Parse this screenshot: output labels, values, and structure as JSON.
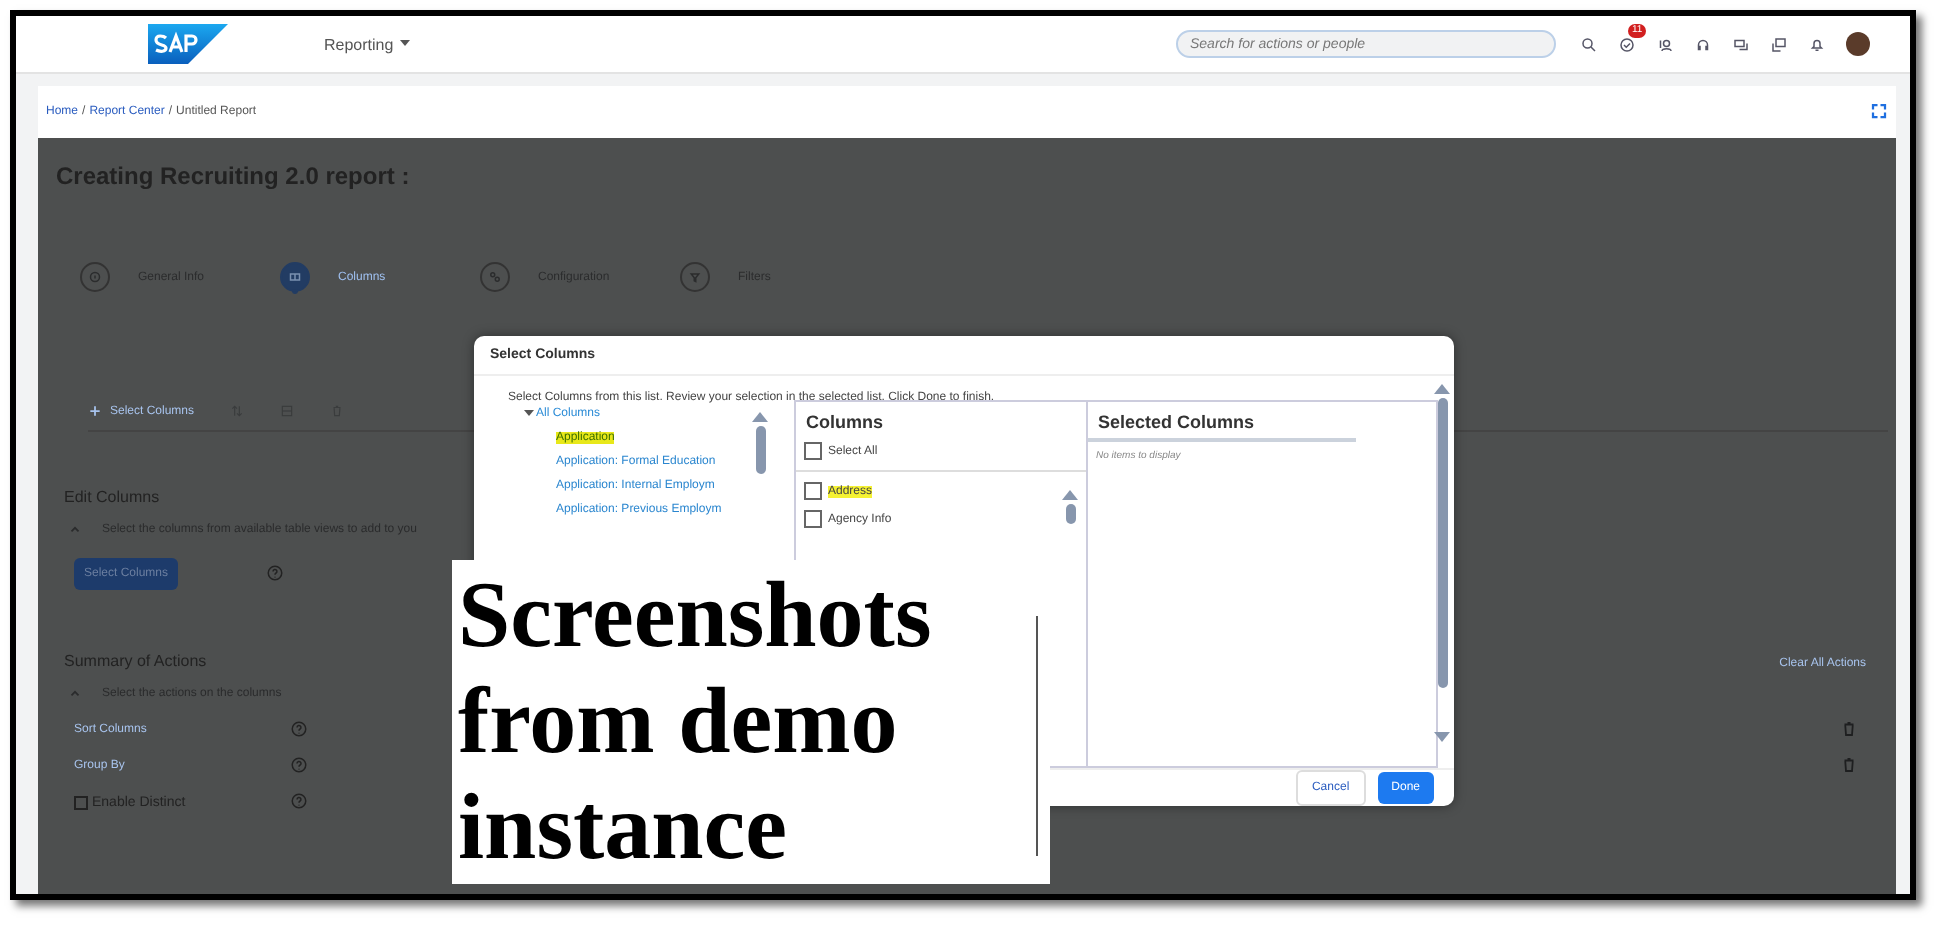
{
  "header": {
    "menu": "Reporting",
    "search": {
      "placeholder": "Search for actions or people"
    },
    "tasks_badge": "11"
  },
  "breadcrumb": {
    "separator": "/",
    "items": [
      "Home",
      "Report Center",
      "Untitled Report"
    ]
  },
  "page": {
    "title": "Creating Recruiting 2.0 report :",
    "steps": [
      {
        "label": "General Info",
        "selected": false
      },
      {
        "label": "Columns",
        "selected": true
      },
      {
        "label": "Configuration",
        "selected": false
      },
      {
        "label": "Filters",
        "selected": false
      }
    ],
    "toolbar": [
      "Select Columns"
    ],
    "edit_columns": {
      "heading": "Edit Columns",
      "description": "Select the columns from available table views to add to you",
      "button": "Select Columns"
    },
    "summary": {
      "heading": "Summary of Actions",
      "description": "Select the actions on the columns",
      "clear": "Clear All Actions",
      "actions": [
        {
          "kind": "link",
          "label": "Sort Columns"
        },
        {
          "kind": "link",
          "label": "Group By"
        },
        {
          "kind": "checkbox",
          "label": "Enable Distinct",
          "checked": false
        }
      ]
    }
  },
  "dialog": {
    "title": "Select Columns",
    "instruction": "Select Columns from this list. Review your selection in the selected list. Click Done to finish.",
    "tree": {
      "label": "All Columns",
      "expanded": true,
      "children": [
        {
          "label": "Application",
          "highlighted": true
        },
        {
          "label": "Application: Formal Education",
          "highlighted": false
        },
        {
          "label": "Application: Internal Employm",
          "highlighted": false
        },
        {
          "label": "Application: Previous Employm",
          "highlighted": false
        }
      ]
    },
    "columns": {
      "heading": "Columns",
      "select_all": {
        "label": "Select All",
        "checked": false
      },
      "items": [
        {
          "label": "Address",
          "checked": false,
          "highlighted": true
        },
        {
          "label": "Agency Info",
          "checked": false,
          "highlighted": false
        }
      ]
    },
    "selected_columns": {
      "heading": "Selected Columns",
      "empty": "No items to display"
    },
    "buttons": [
      {
        "kind": "secondary",
        "label": "Cancel"
      },
      {
        "kind": "primary",
        "label": "Done"
      }
    ]
  },
  "caption": "Screenshots from demo instance"
}
